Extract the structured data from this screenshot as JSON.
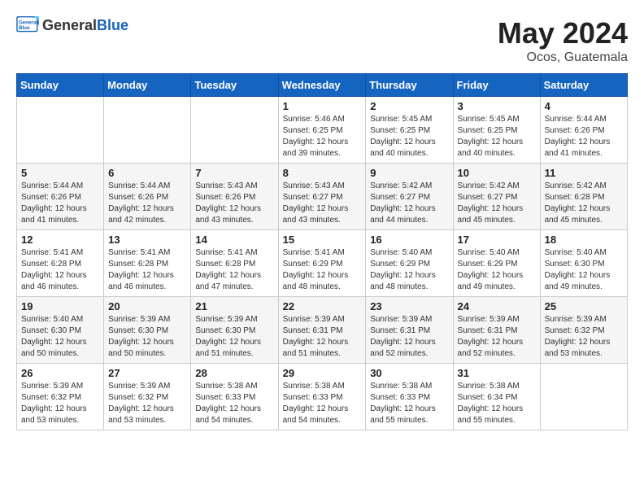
{
  "logo": {
    "general": "General",
    "blue": "Blue"
  },
  "title": {
    "month_year": "May 2024",
    "location": "Ocos, Guatemala"
  },
  "weekdays": [
    "Sunday",
    "Monday",
    "Tuesday",
    "Wednesday",
    "Thursday",
    "Friday",
    "Saturday"
  ],
  "weeks": [
    [
      {
        "day": "",
        "info": ""
      },
      {
        "day": "",
        "info": ""
      },
      {
        "day": "",
        "info": ""
      },
      {
        "day": "1",
        "info": "Sunrise: 5:46 AM\nSunset: 6:25 PM\nDaylight: 12 hours\nand 39 minutes."
      },
      {
        "day": "2",
        "info": "Sunrise: 5:45 AM\nSunset: 6:25 PM\nDaylight: 12 hours\nand 40 minutes."
      },
      {
        "day": "3",
        "info": "Sunrise: 5:45 AM\nSunset: 6:25 PM\nDaylight: 12 hours\nand 40 minutes."
      },
      {
        "day": "4",
        "info": "Sunrise: 5:44 AM\nSunset: 6:26 PM\nDaylight: 12 hours\nand 41 minutes."
      }
    ],
    [
      {
        "day": "5",
        "info": "Sunrise: 5:44 AM\nSunset: 6:26 PM\nDaylight: 12 hours\nand 41 minutes."
      },
      {
        "day": "6",
        "info": "Sunrise: 5:44 AM\nSunset: 6:26 PM\nDaylight: 12 hours\nand 42 minutes."
      },
      {
        "day": "7",
        "info": "Sunrise: 5:43 AM\nSunset: 6:26 PM\nDaylight: 12 hours\nand 43 minutes."
      },
      {
        "day": "8",
        "info": "Sunrise: 5:43 AM\nSunset: 6:27 PM\nDaylight: 12 hours\nand 43 minutes."
      },
      {
        "day": "9",
        "info": "Sunrise: 5:42 AM\nSunset: 6:27 PM\nDaylight: 12 hours\nand 44 minutes."
      },
      {
        "day": "10",
        "info": "Sunrise: 5:42 AM\nSunset: 6:27 PM\nDaylight: 12 hours\nand 45 minutes."
      },
      {
        "day": "11",
        "info": "Sunrise: 5:42 AM\nSunset: 6:28 PM\nDaylight: 12 hours\nand 45 minutes."
      }
    ],
    [
      {
        "day": "12",
        "info": "Sunrise: 5:41 AM\nSunset: 6:28 PM\nDaylight: 12 hours\nand 46 minutes."
      },
      {
        "day": "13",
        "info": "Sunrise: 5:41 AM\nSunset: 6:28 PM\nDaylight: 12 hours\nand 46 minutes."
      },
      {
        "day": "14",
        "info": "Sunrise: 5:41 AM\nSunset: 6:28 PM\nDaylight: 12 hours\nand 47 minutes."
      },
      {
        "day": "15",
        "info": "Sunrise: 5:41 AM\nSunset: 6:29 PM\nDaylight: 12 hours\nand 48 minutes."
      },
      {
        "day": "16",
        "info": "Sunrise: 5:40 AM\nSunset: 6:29 PM\nDaylight: 12 hours\nand 48 minutes."
      },
      {
        "day": "17",
        "info": "Sunrise: 5:40 AM\nSunset: 6:29 PM\nDaylight: 12 hours\nand 49 minutes."
      },
      {
        "day": "18",
        "info": "Sunrise: 5:40 AM\nSunset: 6:30 PM\nDaylight: 12 hours\nand 49 minutes."
      }
    ],
    [
      {
        "day": "19",
        "info": "Sunrise: 5:40 AM\nSunset: 6:30 PM\nDaylight: 12 hours\nand 50 minutes."
      },
      {
        "day": "20",
        "info": "Sunrise: 5:39 AM\nSunset: 6:30 PM\nDaylight: 12 hours\nand 50 minutes."
      },
      {
        "day": "21",
        "info": "Sunrise: 5:39 AM\nSunset: 6:30 PM\nDaylight: 12 hours\nand 51 minutes."
      },
      {
        "day": "22",
        "info": "Sunrise: 5:39 AM\nSunset: 6:31 PM\nDaylight: 12 hours\nand 51 minutes."
      },
      {
        "day": "23",
        "info": "Sunrise: 5:39 AM\nSunset: 6:31 PM\nDaylight: 12 hours\nand 52 minutes."
      },
      {
        "day": "24",
        "info": "Sunrise: 5:39 AM\nSunset: 6:31 PM\nDaylight: 12 hours\nand 52 minutes."
      },
      {
        "day": "25",
        "info": "Sunrise: 5:39 AM\nSunset: 6:32 PM\nDaylight: 12 hours\nand 53 minutes."
      }
    ],
    [
      {
        "day": "26",
        "info": "Sunrise: 5:39 AM\nSunset: 6:32 PM\nDaylight: 12 hours\nand 53 minutes."
      },
      {
        "day": "27",
        "info": "Sunrise: 5:39 AM\nSunset: 6:32 PM\nDaylight: 12 hours\nand 53 minutes."
      },
      {
        "day": "28",
        "info": "Sunrise: 5:38 AM\nSunset: 6:33 PM\nDaylight: 12 hours\nand 54 minutes."
      },
      {
        "day": "29",
        "info": "Sunrise: 5:38 AM\nSunset: 6:33 PM\nDaylight: 12 hours\nand 54 minutes."
      },
      {
        "day": "30",
        "info": "Sunrise: 5:38 AM\nSunset: 6:33 PM\nDaylight: 12 hours\nand 55 minutes."
      },
      {
        "day": "31",
        "info": "Sunrise: 5:38 AM\nSunset: 6:34 PM\nDaylight: 12 hours\nand 55 minutes."
      },
      {
        "day": "",
        "info": ""
      }
    ]
  ]
}
